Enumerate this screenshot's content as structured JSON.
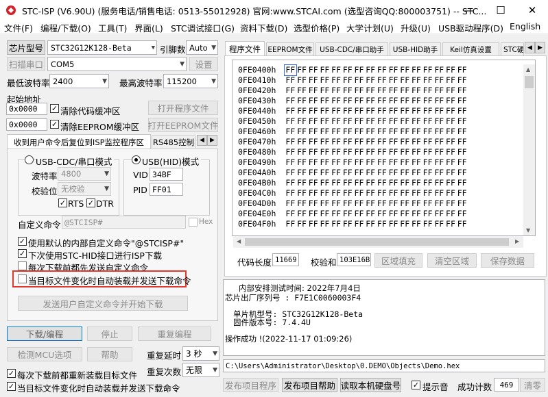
{
  "window": {
    "title": "STC-ISP (V6.90U) (服务电话/销售电话: 0513-55012928) 官网:www.STCAI.com  (选型咨询QQ:800003751) -- STC..."
  },
  "menu": [
    "文件(F)",
    "编程/下载(O)",
    "工具(T)",
    "界面(L)",
    "STC调试接口(G)",
    "资料下载(D)",
    "选型价格(P)",
    "大学计划(U)",
    "升级(U)",
    "USB驱动程序(D)",
    "English"
  ],
  "left": {
    "chip_button": "芯片型号",
    "chip_value": "STC32G12K128-Beta",
    "pin_label": "引脚数",
    "pin_value": "Auto",
    "scan_button": "扫描串口",
    "port_value": "COM5",
    "settings_button": "设置",
    "min_baud_label": "最低波特率",
    "min_baud_value": "2400",
    "max_baud_label": "最高波特率",
    "max_baud_value": "115200",
    "start_addr_label": "起始地址",
    "addr1": "0x0000",
    "clear_code_label": "清除代码缓冲区",
    "open_program_button": "打开程序文件",
    "addr2": "0x0000",
    "clear_eeprom_label": "清除EEPROM缓冲区",
    "open_eeprom_button": "打开EEPROM文件",
    "tabs": [
      "收到用户命令后复位到ISP监控程序区",
      "RS485控制"
    ],
    "usb_cdc_label": "USB-CDC/串口模式",
    "baud_label": "波特率",
    "baud_value": "4800",
    "parity_label": "校验位",
    "parity_value": "无校验",
    "rts_label": "RTS",
    "dtr_label": "DTR",
    "usb_hid_label": "USB(HID)模式",
    "vid_label": "VID",
    "vid_value": "34BF",
    "pid_label": "PID",
    "pid_value": "FF01",
    "custom_cmd_label": "自定义命令",
    "custom_cmd_value": "@STCISP#",
    "hex_label": "Hex",
    "opt1": "使用默认的内部自定义命令\"@STCISP#\"",
    "opt2": "下次使用STC-HID接口进行ISP下载",
    "opt3": "每次下载前都先发送自定义命令",
    "opt4": "当目标文件变化时自动装载并发送下载命令",
    "send_cmd_button": "发送用户自定义命令并开始下载",
    "download_button": "下载/编程",
    "stop_button": "停止",
    "reprogram_button": "重复编程",
    "detect_button": "检测MCU选项",
    "help_button": "帮助",
    "repeat_delay_label": "重复延时",
    "repeat_delay_value": "3 秒",
    "reload_label": "每次下载前都重新装载目标文件",
    "repeat_count_label": "重复次数",
    "repeat_count_value": "无限",
    "auto_reload_label": "当目标文件变化时自动装载并发送下载命令"
  },
  "right": {
    "tabs": [
      "程序文件",
      "EEPROM文件",
      "USB-CDC/串口助手",
      "USB-HID助手",
      "Keil仿真设置",
      "STC硬"
    ],
    "hex_rows": [
      {
        "addr": "0FE0400h"
      },
      {
        "addr": "0FE0410h"
      },
      {
        "addr": "0FE0420h"
      },
      {
        "addr": "0FE0430h"
      },
      {
        "addr": "0FE0440h"
      },
      {
        "addr": "0FE0450h"
      },
      {
        "addr": "0FE0460h"
      },
      {
        "addr": "0FE0470h"
      },
      {
        "addr": "0FE0480h"
      },
      {
        "addr": "0FE0490h"
      },
      {
        "addr": "0FE04A0h"
      },
      {
        "addr": "0FE04B0h"
      },
      {
        "addr": "0FE04C0h"
      },
      {
        "addr": "0FE04D0h"
      },
      {
        "addr": "0FE04E0h"
      },
      {
        "addr": "0FE04F0h"
      }
    ],
    "hex_byte": "FF",
    "code_len_label": "代码长度",
    "code_len_value": "11669",
    "checksum_label": "校验和",
    "checksum_value": "103E16B",
    "fill_button": "区域填充",
    "clear_button": "清空区域",
    "save_button": "保存数据",
    "info": {
      "line1": "内部安排测试时间: 2022年7月4日",
      "line2": "芯片出厂序列号 : F7E1C0060003F4",
      "line3": "单片机型号: STC32G12K128-Beta",
      "line4": "固件版本号: 7.4.4U",
      "line5": "操作成功 !(2022-11-17 01:09:26)"
    },
    "file_path": "C:\\Users\\Administrator\\Desktop\\0.DEMO\\Objects\\Demo.hex",
    "publish_button": "发布项目程序",
    "publish_help_button": "发布项目帮助",
    "read_disk_button": "读取本机硬盘号",
    "beep_label": "提示音",
    "success_count_label": "成功计数",
    "success_count_value": "469",
    "clear_count_button": "清零"
  },
  "colors": {
    "highlight_border": "#e03a2f",
    "window_bg": "#f0f0f0"
  }
}
